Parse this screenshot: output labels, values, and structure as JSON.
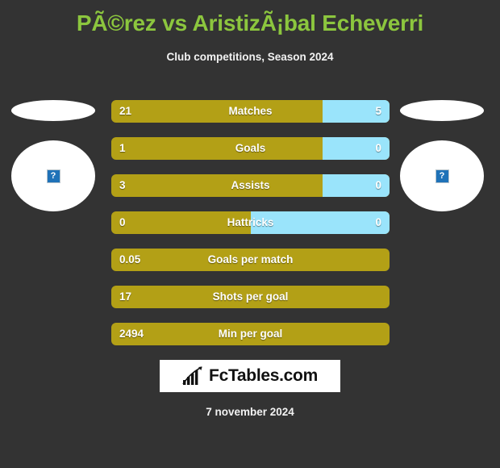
{
  "header": {
    "title": "PÃ©rez vs AristizÃ¡bal Echeverri",
    "subtitle": "Club competitions, Season 2024"
  },
  "players": {
    "left": {
      "photo_icon": "broken-image-icon",
      "photo_glyph": "?"
    },
    "right": {
      "photo_icon": "broken-image-icon",
      "photo_glyph": "?"
    }
  },
  "logo": {
    "icon": "bar-chart-growth-icon",
    "text": "FcTables.com"
  },
  "footer": {
    "date": "7 november 2024"
  },
  "colors": {
    "background": "#333333",
    "title": "#8cc63e",
    "bar_left": "#b3a016",
    "bar_right": "#9ae4fb",
    "text": "#ffffff"
  },
  "chart_data": {
    "type": "bar",
    "title": "PÃ©rez vs AristizÃ¡bal Echeverri",
    "subtitle": "Club competitions, Season 2024",
    "orientation": "horizontal-diverging",
    "series": [
      {
        "name": "left-player",
        "color": "#b3a016"
      },
      {
        "name": "right-player",
        "color": "#9ae4fb"
      }
    ],
    "rows": [
      {
        "label": "Matches",
        "left": "21",
        "right": "5",
        "left_pct": 76,
        "right_pct": 24,
        "has_right": true
      },
      {
        "label": "Goals",
        "left": "1",
        "right": "0",
        "left_pct": 76,
        "right_pct": 24,
        "has_right": true
      },
      {
        "label": "Assists",
        "left": "3",
        "right": "0",
        "left_pct": 76,
        "right_pct": 24,
        "has_right": true
      },
      {
        "label": "Hattricks",
        "left": "0",
        "right": "0",
        "left_pct": 50,
        "right_pct": 50,
        "has_right": true
      },
      {
        "label": "Goals per match",
        "left": "0.05",
        "right": "",
        "left_pct": 100,
        "right_pct": 0,
        "has_right": false
      },
      {
        "label": "Shots per goal",
        "left": "17",
        "right": "",
        "left_pct": 100,
        "right_pct": 0,
        "has_right": false
      },
      {
        "label": "Min per goal",
        "left": "2494",
        "right": "",
        "left_pct": 100,
        "right_pct": 0,
        "has_right": false
      }
    ]
  }
}
